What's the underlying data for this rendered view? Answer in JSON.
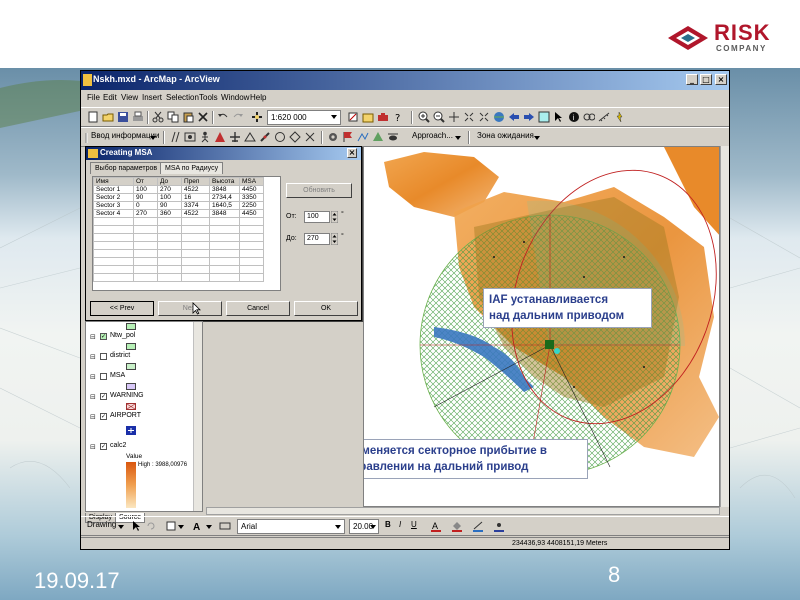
{
  "slide": {
    "date": "19.09.17",
    "page_number": "8",
    "logo_word": "RISK",
    "logo_sub": "COMPANY",
    "brand_color": "#b0162b"
  },
  "app": {
    "title": "Nskh.mxd - ArcMap - ArcView",
    "menu": [
      "File",
      "Edit",
      "View",
      "Insert",
      "Selection",
      "Tools",
      "Window",
      "Help"
    ],
    "scale_value": "1:620 000",
    "toolbar2": {
      "data_entry": "Ввод информации",
      "approach": "Approach...",
      "wait_zone": "Зона ожидания"
    },
    "drawing": {
      "drawing_label": "Drawing",
      "font_name": "Arial",
      "font_size": "20.00"
    },
    "status_coords": "234436,93  4408151,19 Meters"
  },
  "dialog": {
    "title": "Creating MSA",
    "tabs": [
      "Выбор параметров",
      "MSA по Радиусу"
    ],
    "columns": [
      "Имя",
      "От",
      "До",
      "Преп",
      "Высота",
      "MSA"
    ],
    "rows": [
      [
        "Sector 1",
        "100",
        "270",
        "4522",
        "3848",
        "4450"
      ],
      [
        "Sector 2",
        "90",
        "100",
        "16",
        "2734,4",
        "3350"
      ],
      [
        "Sector 3",
        "0",
        "90",
        "3374",
        "1640,5",
        "2250"
      ],
      [
        "Sector 4",
        "270",
        "360",
        "4522",
        "3848",
        "4450"
      ]
    ],
    "update_button": "Обновить",
    "from_label": "От:",
    "from_value": "100",
    "to_label": "До:",
    "to_value": "270",
    "degree_sign": "°",
    "prev_button": "<< Prev",
    "next_button": "Next",
    "cancel_button": "Cancel",
    "ok_button": "OK"
  },
  "toc": {
    "items": [
      {
        "label": "Ntw_pol",
        "checked": true
      },
      {
        "label": "district",
        "checked": false
      },
      {
        "label": "MSA",
        "checked": false
      },
      {
        "label": "WARNING",
        "checked": true
      },
      {
        "label": "AIRPORT",
        "checked": true
      },
      {
        "label": "calc2",
        "checked": true
      }
    ],
    "value_label": "Value",
    "high_label": "High : 3988,00976",
    "tabs": [
      "Display",
      "Source"
    ]
  },
  "callouts": {
    "iaf_line1": "IAF устанавливается",
    "iaf_line2": "над дальним приводом",
    "sector_line1": "Применяется секторное прибытие в",
    "sector_line2": " направлении на дальний привод"
  },
  "colors": {
    "callout_text": "#2b3f8c",
    "msa_circle": "#7fc97f",
    "sector_highlight": "#33d6c8",
    "relief_orange": "#e88a2a",
    "river": "#3a78c0"
  },
  "icons": [
    "arrow-pointer-icon",
    "zoom-in-icon",
    "zoom-out-icon",
    "pan-icon",
    "identify-icon",
    "new-document-icon",
    "open-icon",
    "save-icon",
    "print-icon",
    "cut-icon",
    "copy-icon",
    "paste-icon",
    "delete-icon",
    "undo-icon",
    "redo-icon",
    "add-data-icon"
  ]
}
